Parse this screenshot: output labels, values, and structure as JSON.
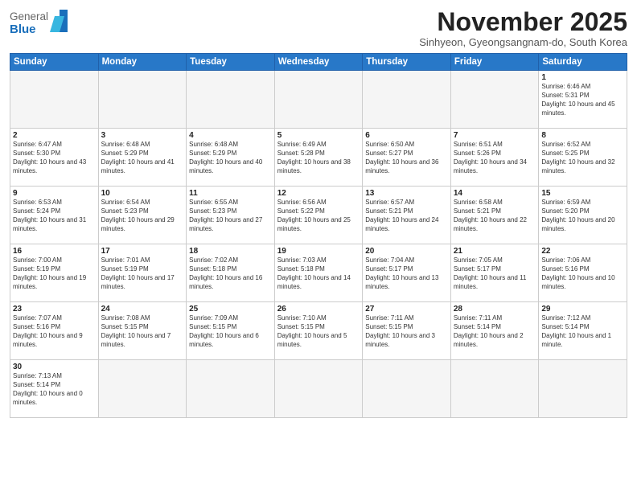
{
  "logo": {
    "general": "General",
    "blue": "Blue"
  },
  "header": {
    "month": "November 2025",
    "location": "Sinhyeon, Gyeongsangnam-do, South Korea"
  },
  "weekdays": [
    "Sunday",
    "Monday",
    "Tuesday",
    "Wednesday",
    "Thursday",
    "Friday",
    "Saturday"
  ],
  "weeks": [
    [
      {
        "day": "",
        "info": ""
      },
      {
        "day": "",
        "info": ""
      },
      {
        "day": "",
        "info": ""
      },
      {
        "day": "",
        "info": ""
      },
      {
        "day": "",
        "info": ""
      },
      {
        "day": "",
        "info": ""
      },
      {
        "day": "1",
        "info": "Sunrise: 6:46 AM\nSunset: 5:31 PM\nDaylight: 10 hours and 45 minutes."
      }
    ],
    [
      {
        "day": "2",
        "info": "Sunrise: 6:47 AM\nSunset: 5:30 PM\nDaylight: 10 hours and 43 minutes."
      },
      {
        "day": "3",
        "info": "Sunrise: 6:48 AM\nSunset: 5:29 PM\nDaylight: 10 hours and 41 minutes."
      },
      {
        "day": "4",
        "info": "Sunrise: 6:48 AM\nSunset: 5:29 PM\nDaylight: 10 hours and 40 minutes."
      },
      {
        "day": "5",
        "info": "Sunrise: 6:49 AM\nSunset: 5:28 PM\nDaylight: 10 hours and 38 minutes."
      },
      {
        "day": "6",
        "info": "Sunrise: 6:50 AM\nSunset: 5:27 PM\nDaylight: 10 hours and 36 minutes."
      },
      {
        "day": "7",
        "info": "Sunrise: 6:51 AM\nSunset: 5:26 PM\nDaylight: 10 hours and 34 minutes."
      },
      {
        "day": "8",
        "info": "Sunrise: 6:52 AM\nSunset: 5:25 PM\nDaylight: 10 hours and 32 minutes."
      }
    ],
    [
      {
        "day": "9",
        "info": "Sunrise: 6:53 AM\nSunset: 5:24 PM\nDaylight: 10 hours and 31 minutes."
      },
      {
        "day": "10",
        "info": "Sunrise: 6:54 AM\nSunset: 5:23 PM\nDaylight: 10 hours and 29 minutes."
      },
      {
        "day": "11",
        "info": "Sunrise: 6:55 AM\nSunset: 5:23 PM\nDaylight: 10 hours and 27 minutes."
      },
      {
        "day": "12",
        "info": "Sunrise: 6:56 AM\nSunset: 5:22 PM\nDaylight: 10 hours and 25 minutes."
      },
      {
        "day": "13",
        "info": "Sunrise: 6:57 AM\nSunset: 5:21 PM\nDaylight: 10 hours and 24 minutes."
      },
      {
        "day": "14",
        "info": "Sunrise: 6:58 AM\nSunset: 5:21 PM\nDaylight: 10 hours and 22 minutes."
      },
      {
        "day": "15",
        "info": "Sunrise: 6:59 AM\nSunset: 5:20 PM\nDaylight: 10 hours and 20 minutes."
      }
    ],
    [
      {
        "day": "16",
        "info": "Sunrise: 7:00 AM\nSunset: 5:19 PM\nDaylight: 10 hours and 19 minutes."
      },
      {
        "day": "17",
        "info": "Sunrise: 7:01 AM\nSunset: 5:19 PM\nDaylight: 10 hours and 17 minutes."
      },
      {
        "day": "18",
        "info": "Sunrise: 7:02 AM\nSunset: 5:18 PM\nDaylight: 10 hours and 16 minutes."
      },
      {
        "day": "19",
        "info": "Sunrise: 7:03 AM\nSunset: 5:18 PM\nDaylight: 10 hours and 14 minutes."
      },
      {
        "day": "20",
        "info": "Sunrise: 7:04 AM\nSunset: 5:17 PM\nDaylight: 10 hours and 13 minutes."
      },
      {
        "day": "21",
        "info": "Sunrise: 7:05 AM\nSunset: 5:17 PM\nDaylight: 10 hours and 11 minutes."
      },
      {
        "day": "22",
        "info": "Sunrise: 7:06 AM\nSunset: 5:16 PM\nDaylight: 10 hours and 10 minutes."
      }
    ],
    [
      {
        "day": "23",
        "info": "Sunrise: 7:07 AM\nSunset: 5:16 PM\nDaylight: 10 hours and 9 minutes."
      },
      {
        "day": "24",
        "info": "Sunrise: 7:08 AM\nSunset: 5:15 PM\nDaylight: 10 hours and 7 minutes."
      },
      {
        "day": "25",
        "info": "Sunrise: 7:09 AM\nSunset: 5:15 PM\nDaylight: 10 hours and 6 minutes."
      },
      {
        "day": "26",
        "info": "Sunrise: 7:10 AM\nSunset: 5:15 PM\nDaylight: 10 hours and 5 minutes."
      },
      {
        "day": "27",
        "info": "Sunrise: 7:11 AM\nSunset: 5:15 PM\nDaylight: 10 hours and 3 minutes."
      },
      {
        "day": "28",
        "info": "Sunrise: 7:11 AM\nSunset: 5:14 PM\nDaylight: 10 hours and 2 minutes."
      },
      {
        "day": "29",
        "info": "Sunrise: 7:12 AM\nSunset: 5:14 PM\nDaylight: 10 hours and 1 minute."
      }
    ],
    [
      {
        "day": "30",
        "info": "Sunrise: 7:13 AM\nSunset: 5:14 PM\nDaylight: 10 hours and 0 minutes."
      },
      {
        "day": "",
        "info": ""
      },
      {
        "day": "",
        "info": ""
      },
      {
        "day": "",
        "info": ""
      },
      {
        "day": "",
        "info": ""
      },
      {
        "day": "",
        "info": ""
      },
      {
        "day": "",
        "info": ""
      }
    ]
  ]
}
